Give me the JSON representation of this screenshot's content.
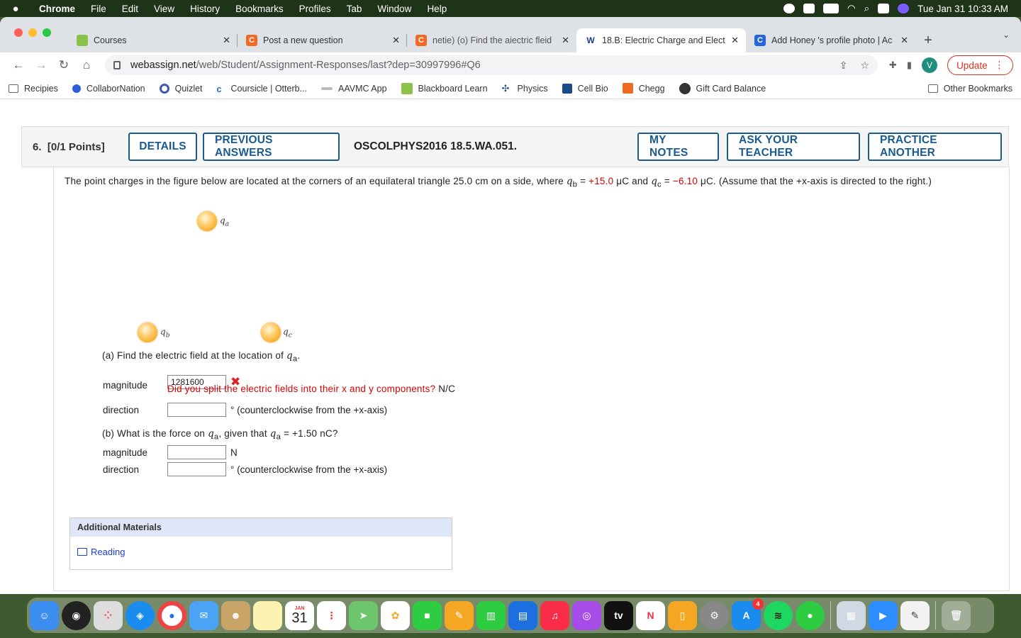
{
  "menubar": {
    "app": "Chrome",
    "items": [
      "File",
      "Edit",
      "View",
      "History",
      "Bookmarks",
      "Profiles",
      "Tab",
      "Window",
      "Help"
    ],
    "clock": "Tue Jan 31  10:33 AM"
  },
  "tabs": [
    {
      "title": "Courses",
      "fav_color": "#8bc34a",
      "fav_text": ""
    },
    {
      "title": "Post a new question",
      "fav_color": "#f06a21",
      "fav_text": "C"
    },
    {
      "title": "netie) (o) Find the aiectric fleid",
      "fav_color": "#f06a21",
      "fav_text": "C"
    },
    {
      "title": "18.B: Electric Charge and Elect",
      "fav_color": "#ffffff",
      "fav_text": "W"
    },
    {
      "title": "Add Honey 's profile photo | Ac",
      "fav_color": "#2466d9",
      "fav_text": "C"
    }
  ],
  "address": {
    "host": "webassign.net",
    "path": "/web/Student/Assignment-Responses/last?dep=30997996#Q6"
  },
  "toolbar": {
    "avatar": "V",
    "update_label": "Update"
  },
  "bookmarks": [
    {
      "label": "Recipies",
      "color": "#777"
    },
    {
      "label": "CollaborNation",
      "color": "#2b5fd9"
    },
    {
      "label": "Quizlet",
      "color": "#4257b2"
    },
    {
      "label": "Coursicle | Otterb...",
      "color": "#2266cc"
    },
    {
      "label": "AAVMC App",
      "color": "#888"
    },
    {
      "label": "Blackboard Learn",
      "color": "#8bc34a"
    },
    {
      "label": "Physics",
      "color": "#2a4f88"
    },
    {
      "label": "Cell Bio",
      "color": "#1b4a8a"
    },
    {
      "label": "Chegg",
      "color": "#f06a21"
    },
    {
      "label": "Gift Card Balance",
      "color": "#333"
    }
  ],
  "other_bookmarks": "Other Bookmarks",
  "question": {
    "number": "6.",
    "points": "[0/1 Points]",
    "details": "DETAILS",
    "previous_answers": "PREVIOUS ANSWERS",
    "code": "OSCOLPHYS2016 18.5.WA.051.",
    "my_notes": "MY NOTES",
    "ask_teacher": "ASK YOUR TEACHER",
    "practice": "PRACTICE ANOTHER"
  },
  "problem": {
    "t1": "The point charges in the figure below are located at the corners of an equilateral triangle 25.0 cm on a side, where ",
    "qb": "q",
    "qb_sub": "b",
    "eq1": " = ",
    "qb_val": "+15.0",
    "t2": " μC and  ",
    "qc": "q",
    "qc_sub": "c",
    "eq2": " = ",
    "qc_val": "−6.10",
    "t3": " μC.  (Assume that the +x-axis is directed to the right.)"
  },
  "figure": {
    "qa": "a",
    "qb": "b",
    "qc": "c",
    "q": "q"
  },
  "part_a": {
    "prompt_pre": "(a) Find the electric field at the location of ",
    "prompt_var": "q",
    "prompt_sub": "a",
    "prompt_post": ".",
    "magnitude_label": "magnitude",
    "magnitude_value": "1281600",
    "feedback": "Did you split the electric fields into their x and y components?",
    "unit": "N/C",
    "direction_label": "direction",
    "direction_value": "",
    "direction_unit": "° (counterclockwise from the +x-axis)"
  },
  "part_b": {
    "prompt_pre": "(b) What is the force on ",
    "prompt_var": "q",
    "prompt_sub": "a",
    "prompt_mid": ", given that ",
    "prompt_var2": "q",
    "prompt_sub2": "a",
    "prompt_post": " = +1.50 nC?",
    "magnitude_label": "magnitude",
    "magnitude_value": "",
    "unit": "N",
    "direction_label": "direction",
    "direction_value": "",
    "direction_unit": "° (counterclockwise from the +x-axis)"
  },
  "additional": {
    "header": "Additional Materials",
    "link": "Reading"
  },
  "dock": {
    "calendar_month": "JAN",
    "calendar_day": "31",
    "appstore_badge": "4"
  }
}
